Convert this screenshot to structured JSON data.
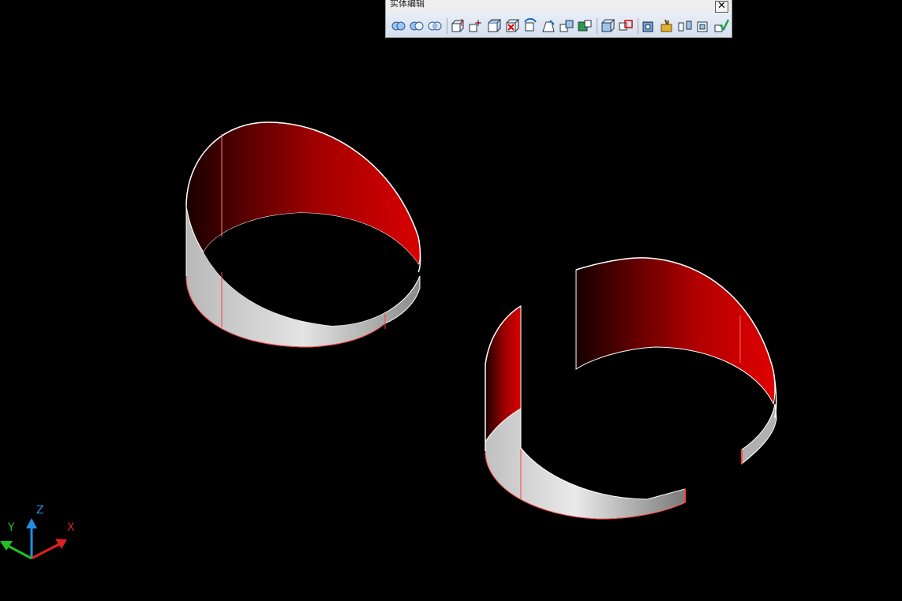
{
  "toolbar": {
    "title": "实体编辑",
    "close_glyph": "✕",
    "buttons": [
      {
        "icon": "union-icon"
      },
      {
        "icon": "subtract-icon"
      },
      {
        "icon": "intersect-icon"
      },
      {
        "icon": "extrude-faces-icon"
      },
      {
        "icon": "move-faces-icon"
      },
      {
        "icon": "offset-faces-icon"
      },
      {
        "icon": "delete-faces-icon"
      },
      {
        "icon": "rotate-faces-icon"
      },
      {
        "icon": "taper-faces-icon"
      },
      {
        "icon": "copy-faces-icon"
      },
      {
        "icon": "color-faces-icon"
      },
      {
        "icon": "copy-edges-icon"
      },
      {
        "icon": "color-edges-icon"
      },
      {
        "icon": "imprint-icon"
      },
      {
        "icon": "clean-icon"
      },
      {
        "icon": "separate-icon"
      },
      {
        "icon": "shell-icon"
      },
      {
        "icon": "check-icon"
      }
    ]
  },
  "ucs_icon": {
    "x_label": "X",
    "y_label": "Y",
    "z_label": "Z"
  },
  "colors": {
    "background": "#000000",
    "inner_face": "#d00000",
    "outer_face": "#e0e0e0",
    "x_axis": "#e02020",
    "y_axis": "#20c020",
    "z_axis": "#2090e0"
  }
}
